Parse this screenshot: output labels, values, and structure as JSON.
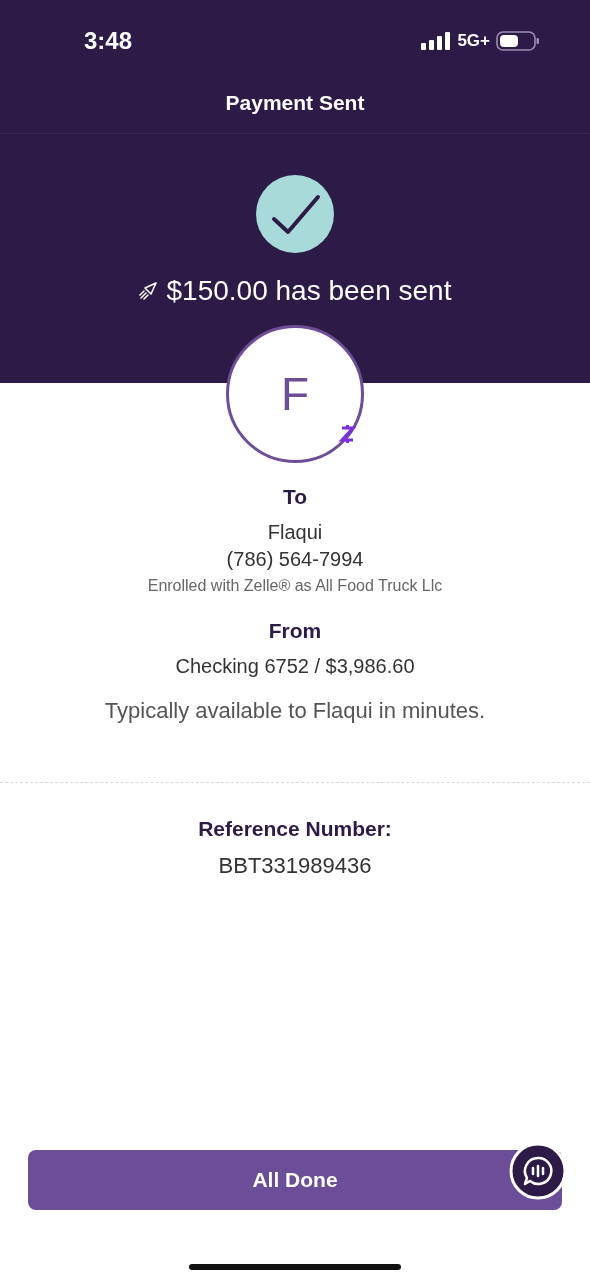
{
  "status_bar": {
    "time": "3:48",
    "network": "5G+"
  },
  "header": {
    "title": "Payment Sent",
    "message": "$150.00 has been sent"
  },
  "recipient": {
    "initial": "F",
    "heading": "To",
    "name": "Flaqui",
    "phone": "(786) 564-7994",
    "enrollment": "Enrolled with Zelle® as All Food Truck Llc"
  },
  "sender": {
    "heading": "From",
    "account": "Checking 6752 / $3,986.60"
  },
  "availability": "Typically available to Flaqui in minutes.",
  "reference": {
    "label": "Reference Number:",
    "value": "BBT331989436"
  },
  "button": {
    "label": "All Done"
  }
}
